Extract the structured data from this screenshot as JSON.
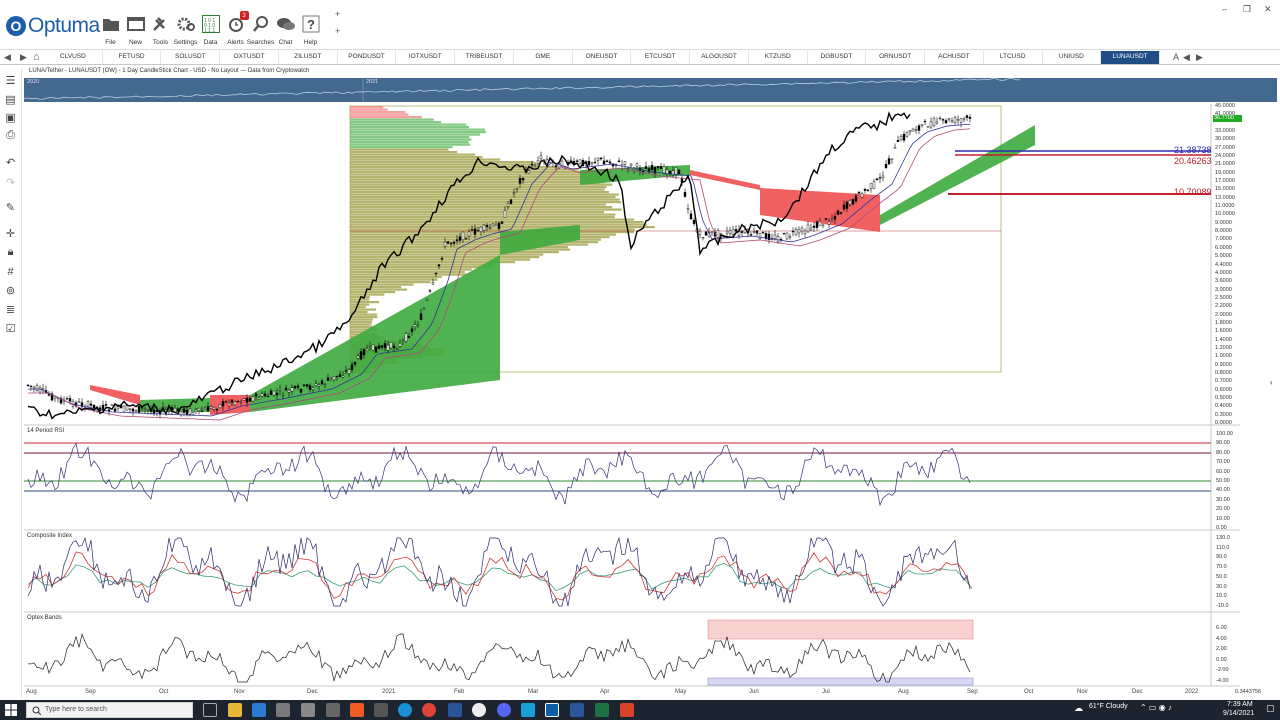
{
  "app": {
    "logo_text": "Optuma",
    "logo_letter": "O"
  },
  "ribbon": {
    "buttons": [
      {
        "label": "File",
        "icon": "folder-icon"
      },
      {
        "label": "New",
        "icon": "new-window-icon"
      },
      {
        "label": "Tools",
        "icon": "tools-icon"
      },
      {
        "label": "Settings",
        "icon": "gear-icon"
      },
      {
        "label": "Data",
        "icon": "binary-data-icon"
      },
      {
        "label": "Alerts",
        "icon": "alarm-clock-icon",
        "badge": "3"
      },
      {
        "label": "Searches",
        "icon": "search-icon"
      },
      {
        "label": "Chat",
        "icon": "chat-icon"
      },
      {
        "label": "Help",
        "icon": "help-icon"
      }
    ],
    "win_controls": {
      "min": "–",
      "restore": "❐",
      "close": "✕"
    },
    "plus_symbol": "+"
  },
  "tabs": {
    "items": [
      "CLVUSD",
      "FETUSD",
      "SOLUSDT",
      "OXTUSDT",
      "ZILUSDT",
      "PONDUSDT",
      "IOTXUSDT",
      "TRIBEUSDT",
      "GME",
      "ONEUSDT",
      "ETCUSDT",
      "ALGOUSDT",
      "KTZUSD",
      "DGBUSDT",
      "ORNUSDT",
      "ACHUSDT",
      "LTCUSD",
      "UNIUSD",
      "LUNAUSDT"
    ],
    "active": "LUNAUSDT",
    "overflow_label": "A",
    "nav_back": "◀",
    "nav_forward": "▶",
    "home": "⌂"
  },
  "chart": {
    "title": "LUNA/Tether - LUNAUSDT (OW) - 1 Day CandleStick Chart - USD - No Layout — Data from Cryptowatch",
    "overview_years": [
      "2020",
      "2021"
    ],
    "price_axis": [
      "45.0000",
      "41.0000",
      "36.7700",
      "33.0000",
      "30.0000",
      "27.0000",
      "24.0000",
      "21.0000",
      "19.0000",
      "17.0000",
      "15.0000",
      "13.0000",
      "11.0000",
      "10.0000",
      "9.0000",
      "8.0000",
      "7.0000",
      "6.0000",
      "5.0000",
      "4.4000",
      "4.0000",
      "3.6000",
      "3.0000",
      "2.5000",
      "2.2000",
      "2.0000",
      "1.8000",
      "1.6000",
      "1.4000",
      "1.2000",
      "1.0000",
      "0.9000",
      "0.8000",
      "0.7000",
      "0.6000",
      "0.5000",
      "0.4000",
      "0.3000",
      "0.0000"
    ],
    "last_price": "36.7700",
    "levels": [
      {
        "value": "21.38738",
        "color": "#2b2bb0"
      },
      {
        "value": "20.46263",
        "color": "#c0202e"
      },
      {
        "value": "10.70089",
        "color": "#c0202e"
      }
    ],
    "x_axis": [
      "Aug",
      "Sep",
      "Oct",
      "Nov",
      "Dec",
      "2021",
      "Feb",
      "Mar",
      "Apr",
      "May",
      "Jun",
      "Jul",
      "Aug",
      "Sep",
      "Oct",
      "Nov",
      "Dec",
      "2022"
    ],
    "x_corner_value": "0.3443756",
    "colors": {
      "cloud_bull": "#3daa3d",
      "cloud_bear": "#f05050",
      "volume_profile": "#9a9a3a",
      "price": "#000000"
    }
  },
  "rsi": {
    "label": "14 Period RSI",
    "axis": [
      "100.00",
      "90.00",
      "80.00",
      "70.00",
      "60.00",
      "50.00",
      "40.00",
      "30.00",
      "20.00",
      "10.00",
      "0.00"
    ]
  },
  "composite": {
    "label": "Composite Index",
    "axis": [
      "130.0",
      "110.0",
      "90.0",
      "70.0",
      "50.0",
      "30.0",
      "10.0",
      "-10.0"
    ]
  },
  "optex": {
    "label": "Optex Bands",
    "axis": [
      "6.00",
      "4.00",
      "2.00",
      "0.00",
      "-2.00",
      "-4.00"
    ]
  },
  "taskbar": {
    "search_placeholder": "Type here to search",
    "weather": "61°F Cloudy",
    "time": "7:39 AM",
    "date": "9/14/2021"
  }
}
